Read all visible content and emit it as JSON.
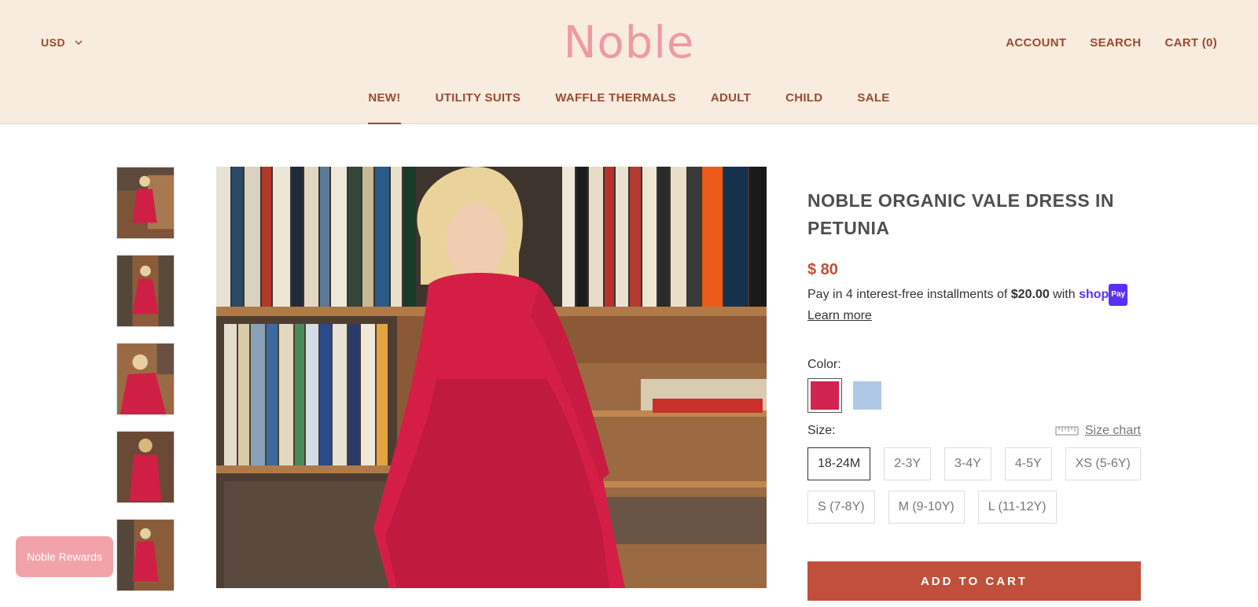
{
  "header": {
    "currency": "USD",
    "logo": "Noble",
    "links": [
      "ACCOUNT",
      "SEARCH",
      "CART (0)"
    ]
  },
  "nav": {
    "items": [
      "NEW!",
      "UTILITY SUITS",
      "WAFFLE THERMALS",
      "ADULT",
      "CHILD",
      "SALE"
    ],
    "active": "NEW!"
  },
  "product": {
    "title": "NOBLE ORGANIC VALE DRESS IN PETUNIA",
    "price": "$ 80",
    "installments_prefix": "Pay in 4 interest-free installments of ",
    "installments_amount": "$20.00",
    "installments_suffix": " with ",
    "shop_pay_brand": "shop",
    "shop_pay_badge": "Pay",
    "learn_more": "Learn more",
    "color_label": "Color:",
    "colors": [
      {
        "name": "petunia",
        "hex": "#d0234f",
        "selected": true
      },
      {
        "name": "blue",
        "hex": "#aec8e6",
        "selected": false
      }
    ],
    "size_label": "Size:",
    "size_chart": "Size chart",
    "sizes": [
      "18-24M",
      "2-3Y",
      "3-4Y",
      "4-5Y",
      "XS (5-6Y)",
      "S (7-8Y)",
      "M (9-10Y)",
      "L (11-12Y)"
    ],
    "selected_size": "18-24M",
    "add_to_cart": "ADD TO CART"
  },
  "rewards": "Noble Rewards",
  "colors": {
    "header_bg": "#f8ecdf",
    "logo": "#ee9aa1",
    "nav_text": "#9c4a2f",
    "accent": "#c0503b"
  }
}
